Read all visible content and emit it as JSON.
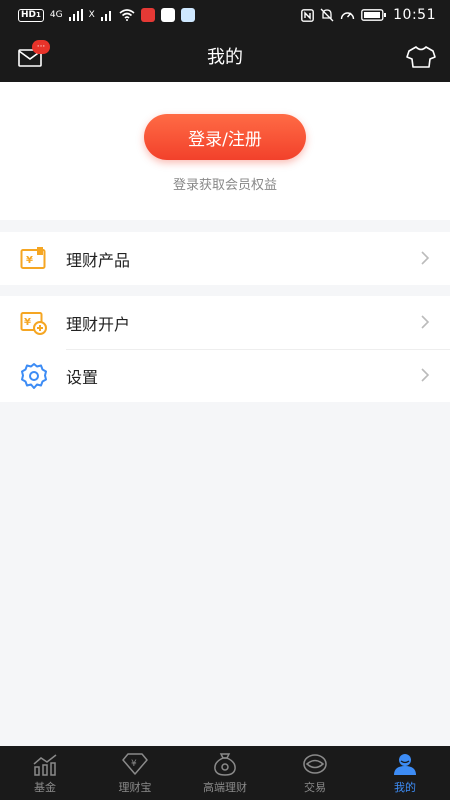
{
  "status_bar": {
    "hd": "HD",
    "hd_sub": "1",
    "network_4g": "4G",
    "network_x": "X",
    "time": "10:51"
  },
  "nav": {
    "title": "我的",
    "message_badge": "···"
  },
  "login": {
    "button_label": "登录/注册",
    "subtitle": "登录获取会员权益"
  },
  "menu_group_1": {
    "items": [
      {
        "label": "理财产品",
        "icon": "finance-product-icon"
      }
    ]
  },
  "menu_group_2": {
    "items": [
      {
        "label": "理财开户",
        "icon": "account-open-icon"
      },
      {
        "label": "设置",
        "icon": "gear-icon"
      }
    ]
  },
  "tabs": [
    {
      "label": "基金",
      "icon": "fund-chart-icon",
      "active": false
    },
    {
      "label": "理财宝",
      "icon": "diamond-yen-icon",
      "active": false
    },
    {
      "label": "高端理财",
      "icon": "money-bag-icon",
      "active": false
    },
    {
      "label": "交易",
      "icon": "eye-trade-icon",
      "active": false
    },
    {
      "label": "我的",
      "icon": "person-icon",
      "active": true
    }
  ],
  "colors": {
    "accent": "#3d8cf5",
    "login_button": "#f2412b",
    "icon_orange": "#f5a623",
    "icon_blue": "#3d8cf5",
    "dark_bar": "#1a1a1a"
  }
}
